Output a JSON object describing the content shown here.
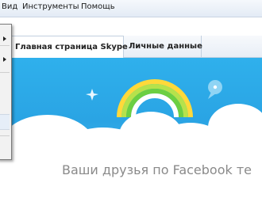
{
  "menubar": {
    "items": [
      {
        "label": "Вид"
      },
      {
        "label": "Инструменты"
      },
      {
        "label": "Помощь"
      }
    ]
  },
  "tabs": [
    {
      "label": "Главная страница Skype",
      "active": true
    },
    {
      "label": "Личные данные",
      "active": false
    }
  ],
  "banner": {
    "headline": "Ваши друзья по Facebook те"
  },
  "colors": {
    "banner_blue": "#2aa4e4",
    "headline_gray": "#8a8a8a"
  },
  "icons": [
    "submenu-arrow-icon",
    "rainbow-illustration",
    "speech-bubble-icon",
    "star-icon"
  ]
}
